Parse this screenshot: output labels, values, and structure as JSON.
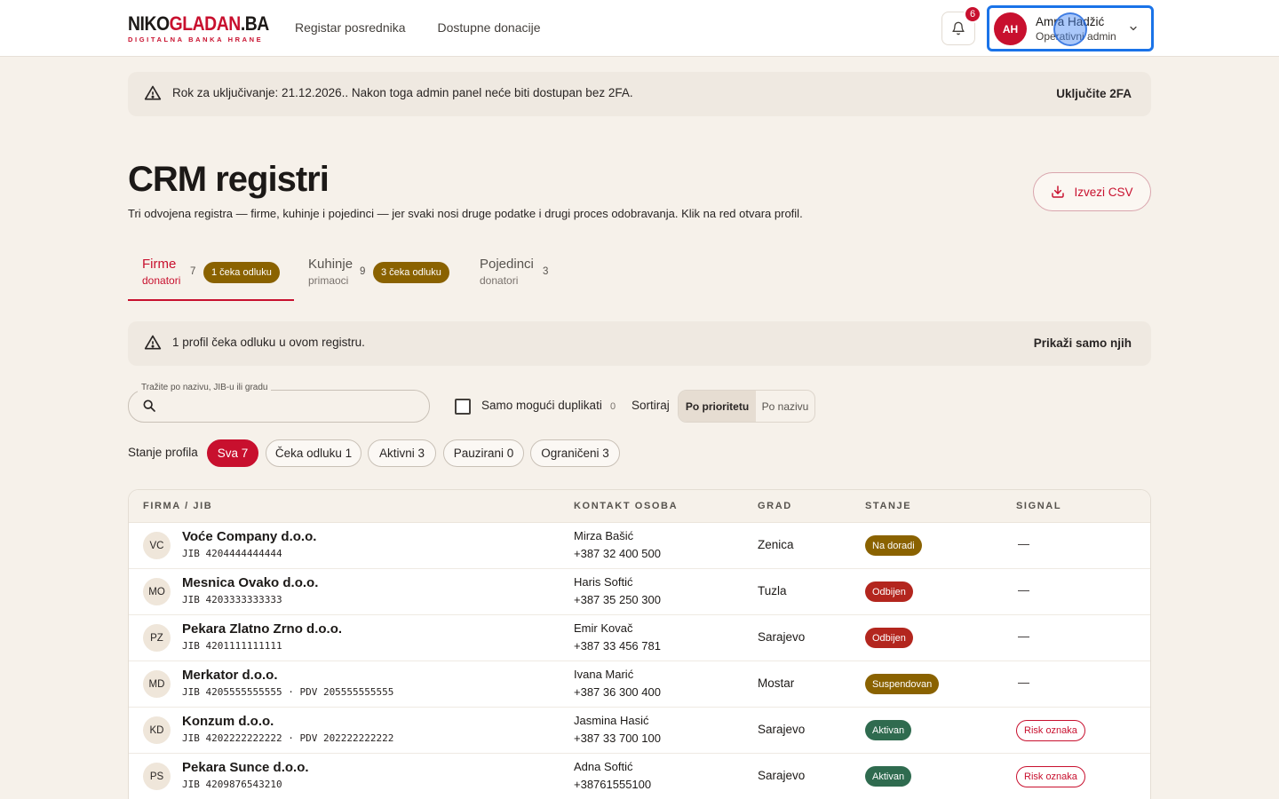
{
  "header": {
    "logo_main_dark": "NIKO",
    "logo_main_red": "GLADAN",
    "logo_main_dark2": ".BA",
    "logo_sub": "DIGITALNA BANKA HRANE",
    "nav": [
      "Registar posrednika",
      "Dostupne donacije"
    ],
    "notifications_count": "6",
    "user": {
      "initials": "AH",
      "name": "Amra Hadžić",
      "role": "Operativni admin"
    }
  },
  "colors": {
    "brand_red": "#c8102e",
    "pending_gold": "#8a6200",
    "active_green": "#2f6b4f",
    "rejected_red": "#b3261e",
    "focus_blue": "#1a73e8"
  },
  "banner_2fa": {
    "text": "Rok za uključivanje: 21.12.2026.. Nakon toga admin panel neće biti dostupan bez 2FA.",
    "action": "Uključite 2FA",
    "icon": "warning-icon"
  },
  "page": {
    "title": "CRM registri",
    "subtitle": "Tri odvojena registra — firme, kuhinje i pojedinci — jer svaki nosi druge podatke i drugi proces odobravanja. Klik na red otvara profil.",
    "export_label": "Izvezi CSV"
  },
  "tabs": [
    {
      "name": "Firme",
      "sub": "donatori",
      "count": "7",
      "pill": "1 čeka odluku"
    },
    {
      "name": "Kuhinje",
      "sub": "primaoci",
      "count": "9",
      "pill": "3 čeka odluku"
    },
    {
      "name": "Pojedinci",
      "sub": "donatori",
      "count": "3",
      "pill": ""
    }
  ],
  "banner_pending": {
    "text": "1 profil čeka odluku u ovom registru.",
    "action": "Prikaži samo njih"
  },
  "search": {
    "label": "Tražite po nazivu, JIB-u ili gradu",
    "value": ""
  },
  "duplicates": {
    "label": "Samo mogući duplikati",
    "count": "0"
  },
  "sort": {
    "label": "Sortiraj",
    "options": [
      "Po prioritetu",
      "Po nazivu"
    ],
    "selected": "Po prioritetu"
  },
  "filters": {
    "label": "Stanje profila",
    "chips": [
      "Sva 7",
      "Čeka odluku 1",
      "Aktivni 3",
      "Pauzirani 0",
      "Ograničeni 3"
    ]
  },
  "table": {
    "headers": [
      "FIRMA / JIB",
      "KONTAKT OSOBA",
      "GRAD",
      "STANJE",
      "SIGNAL"
    ],
    "rows": [
      {
        "initials": "VC",
        "name": "Voće Company d.o.o.",
        "jib": "JIB 4204444444444",
        "contact": "Mirza Bašić",
        "phone": "+387 32 400 500",
        "city": "Zenica",
        "status": "Na doradi",
        "status_color": "#8a6200",
        "signal": "—"
      },
      {
        "initials": "MO",
        "name": "Mesnica Ovako d.o.o.",
        "jib": "JIB 4203333333333",
        "contact": "Haris Softić",
        "phone": "+387 35 250 300",
        "city": "Tuzla",
        "status": "Odbijen",
        "status_color": "#b3261e",
        "signal": "—"
      },
      {
        "initials": "PZ",
        "name": "Pekara Zlatno Zrno d.o.o.",
        "jib": "JIB 4201111111111",
        "contact": "Emir Kovač",
        "phone": "+387 33 456 781",
        "city": "Sarajevo",
        "status": "Odbijen",
        "status_color": "#b3261e",
        "signal": "—"
      },
      {
        "initials": "MD",
        "name": "Merkator d.o.o.",
        "jib": "JIB 4205555555555 · PDV 205555555555",
        "contact": "Ivana Marić",
        "phone": "+387 36 300 400",
        "city": "Mostar",
        "status": "Suspendovan",
        "status_color": "#8a6200",
        "signal": "—"
      },
      {
        "initials": "KD",
        "name": "Konzum d.o.o.",
        "jib": "JIB 4202222222222 · PDV 202222222222",
        "contact": "Jasmina Hasić",
        "phone": "+387 33 700 100",
        "city": "Sarajevo",
        "status": "Aktivan",
        "status_color": "#2f6b4f",
        "signal": "Risk oznaka"
      },
      {
        "initials": "PS",
        "name": "Pekara Sunce d.o.o.",
        "jib": "JIB 4209876543210",
        "contact": "Adna Softić",
        "phone": "+38761555100",
        "city": "Sarajevo",
        "status": "Aktivan",
        "status_color": "#2f6b4f",
        "signal": "Risk oznaka"
      }
    ]
  }
}
